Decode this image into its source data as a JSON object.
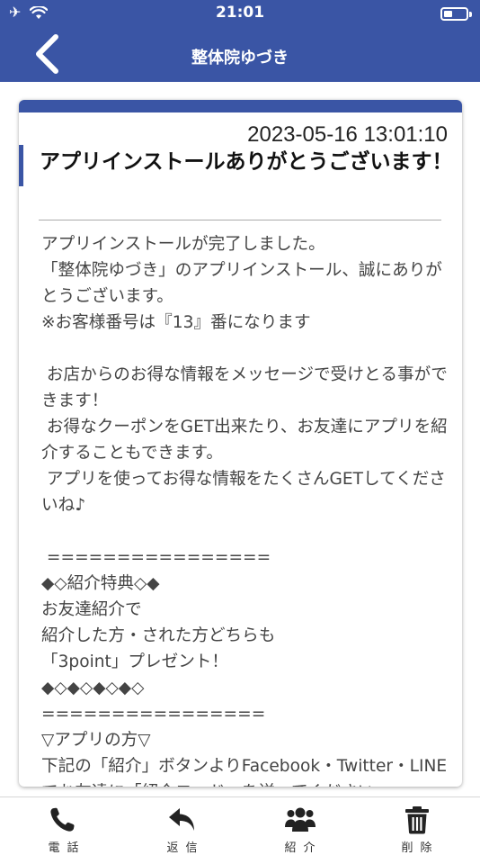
{
  "status_bar": {
    "time": "21:01"
  },
  "header": {
    "title": "整体院ゆづき"
  },
  "message": {
    "date": "2023-05-16 13:01:10",
    "title": "アプリインストールありがとうございます！",
    "body": "アプリインストールが完了しました。\n「整体院ゆづき」のアプリインストール、誠にありがとうございます。\n※お客様番号は『13』番になります\n\n お店からのお得な情報をメッセージで受けとる事ができます！\n お得なクーポンをGET出来たり、お友達にアプリを紹介することもできます。\n アプリを使ってお得な情報をたくさんGETしてくださいね♪\n\n ================\n◆◇紹介特典◇◆\nお友達紹介で\n紹介した方・された方どちらも\n「3point」プレゼント！\n◆◇◆◇◆◇◆◇\n================\n▽アプリの方▽\n下記の「紹介」ボタンよりFacebook・Twitter・LINEでお友達に「紹介コード」を送ってください"
  },
  "tabbar": {
    "phone": "電話",
    "reply": "返信",
    "refer": "紹介",
    "delete": "削除"
  },
  "colors": {
    "brand": "#3a55a5"
  }
}
